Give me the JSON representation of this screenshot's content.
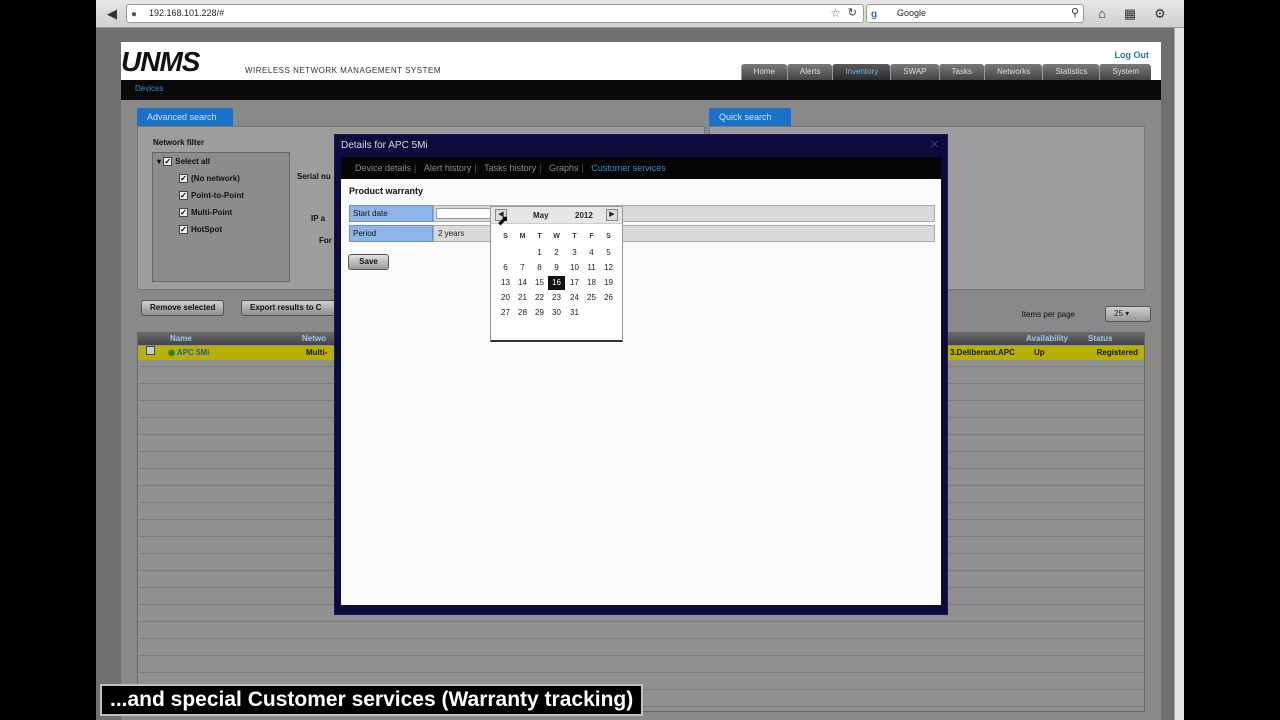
{
  "browser": {
    "url": "192.168.101.228/#",
    "search_engine": "Google",
    "icons": [
      "back-icon",
      "site-icon",
      "bookmark-star-icon",
      "reload-icon",
      "search-icon",
      "home-icon",
      "addon-icon",
      "extension-icon"
    ]
  },
  "app": {
    "logo": "UNMS",
    "subtitle": "WIRELESS NETWORK MANAGEMENT SYSTEM",
    "logout": "Log Out",
    "nav_tabs": [
      {
        "label": "Home"
      },
      {
        "label": "Alerts"
      },
      {
        "label": "Inventory"
      },
      {
        "label": "SWAP"
      },
      {
        "label": "Tasks"
      },
      {
        "label": "Networks"
      },
      {
        "label": "Statistics"
      },
      {
        "label": "System"
      }
    ],
    "active_tab": "Inventory",
    "breadcrumb": "Devices"
  },
  "advanced_search": {
    "title": "Advanced search",
    "network_filter_title": "Network filter",
    "tree": [
      "Select all",
      "(No network)",
      "Point-to-Point",
      "Multi-Point",
      "HotSpot"
    ],
    "serial_label": "Serial nu",
    "ip_label": "IP a",
    "for_label": "For"
  },
  "quick_search": {
    "title": "Quick search"
  },
  "actions": {
    "remove_selected": "Remove selected",
    "export_results": "Export results to C"
  },
  "items_per_page": {
    "label": "Items per page",
    "value": "25"
  },
  "table": {
    "columns": [
      "Name",
      "Netwo",
      "Availability",
      "Status"
    ],
    "row": {
      "name": "APC 5Mi",
      "network": "Multi-",
      "hostname": "3.Deliberant.APC",
      "availability": "Up",
      "status": "Registered"
    }
  },
  "modal": {
    "title": "Details for APC 5Mi",
    "tabs": [
      {
        "label": "Device details"
      },
      {
        "label": "Alert history"
      },
      {
        "label": "Tasks history"
      },
      {
        "label": "Graphs"
      },
      {
        "label": "Customer services"
      }
    ],
    "active_tab": "Customer services",
    "section_title": "Product warranty",
    "start_date_label": "Start date",
    "start_date_value": "",
    "period_label": "Period",
    "period_value": "2 years",
    "save_label": "Save"
  },
  "calendar": {
    "month": "May",
    "year": "2012",
    "weekdays": [
      "S",
      "M",
      "T",
      "W",
      "T",
      "F",
      "S"
    ],
    "weeks": [
      [
        "",
        "",
        "1",
        "2",
        "3",
        "4",
        "5"
      ],
      [
        "6",
        "7",
        "8",
        "9",
        "10",
        "11",
        "12"
      ],
      [
        "13",
        "14",
        "15",
        "16",
        "17",
        "18",
        "19"
      ],
      [
        "20",
        "21",
        "22",
        "23",
        "24",
        "25",
        "26"
      ],
      [
        "27",
        "28",
        "29",
        "30",
        "31",
        "",
        ""
      ]
    ],
    "selected_day": "16"
  },
  "caption": "...and special Customer services (Warranty tracking)"
}
